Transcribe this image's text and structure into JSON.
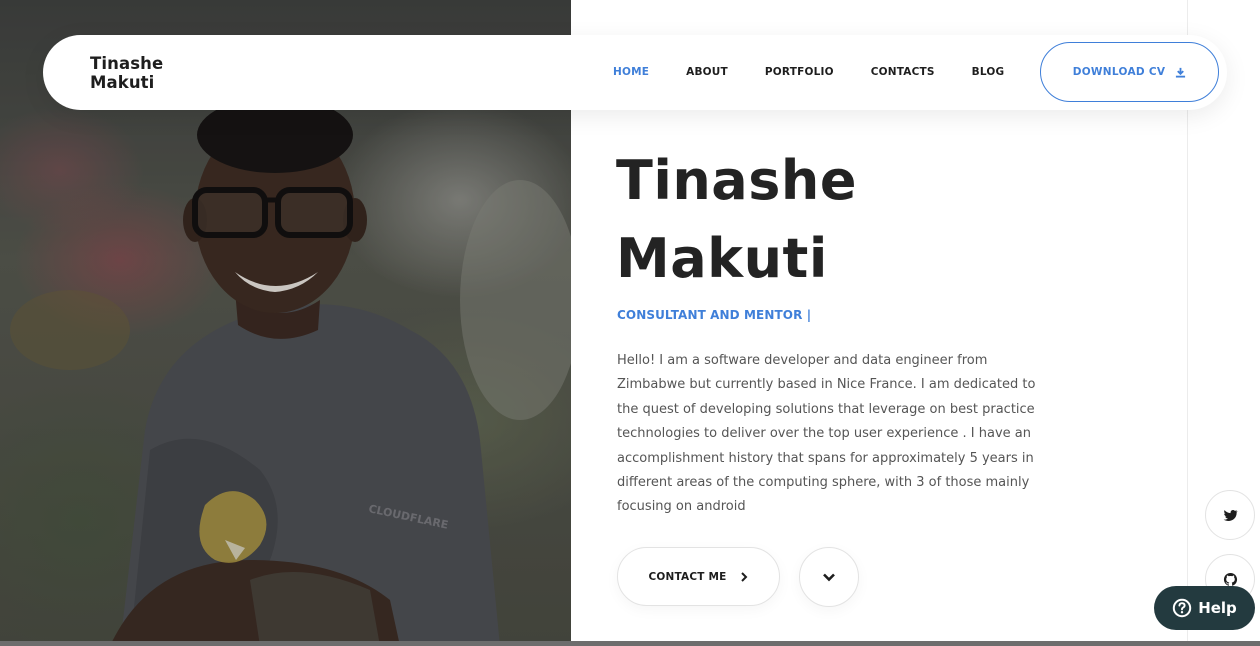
{
  "brand": {
    "line1": "Tinashe",
    "line2": "Makuti"
  },
  "nav": {
    "items": [
      {
        "label": "HOME",
        "active": true
      },
      {
        "label": "ABOUT",
        "active": false
      },
      {
        "label": "PORTFOLIO",
        "active": false
      },
      {
        "label": "CONTACTS",
        "active": false
      },
      {
        "label": "BLOG",
        "active": false
      }
    ],
    "download_label": "DOWNLOAD CV",
    "download_icon": "download-icon"
  },
  "hero": {
    "name_line1": "Tinashe",
    "name_line2": "Makuti",
    "subtitle": "CONSULTANT AND MENTOR |",
    "bio": "Hello! I am a software developer and data engineer from Zimbabwe but currently based in Nice France. I am dedicated to the quest of developing solutions that leverage on best practice technologies to deliver over the top user experience . I have an accomplishment history that spans for approximately 5 years in different areas of the computing sphere, with 3 of those mainly focusing on android",
    "contact_label": "CONTACT ME",
    "contact_icon": "chevron-right-icon",
    "scroll_icon": "chevron-down-icon"
  },
  "photo": {
    "shirt_text": "CLOUDFLARE"
  },
  "social": {
    "items": [
      {
        "name": "twitter",
        "icon": "twitter-icon"
      },
      {
        "name": "github",
        "icon": "github-icon"
      }
    ]
  },
  "help": {
    "label": "Help",
    "icon": "help-circle-icon"
  },
  "colors": {
    "accent": "#3f7fd9",
    "text_dark": "#232323",
    "help_bg": "#233a3f"
  }
}
